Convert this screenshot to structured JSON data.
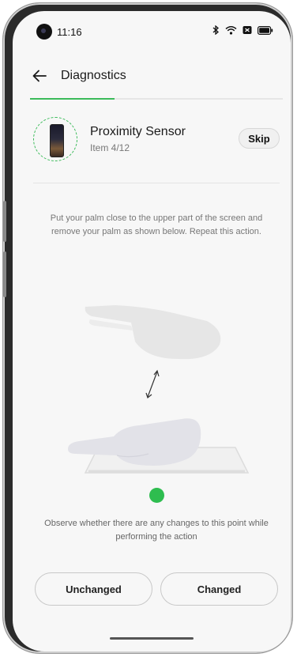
{
  "status_bar": {
    "time": "11:16",
    "icons": [
      "bluetooth-icon",
      "wifi-icon",
      "sim-icon",
      "battery-icon"
    ]
  },
  "header": {
    "title": "Diagnostics"
  },
  "progress": {
    "fraction": 0.333,
    "accent_color": "#3bbb5a"
  },
  "sensor": {
    "name": "Proximity Sensor",
    "item": "Item 4/12",
    "skip_label": "Skip"
  },
  "instruction": "Put your palm close to the upper part of the screen and remove your palm as shown below. Repeat this action.",
  "indicator_color": "#2ebd4f",
  "observe_text": "Observe whether there are any changes to this point while performing the action",
  "buttons": {
    "unchanged": "Unchanged",
    "changed": "Changed"
  }
}
